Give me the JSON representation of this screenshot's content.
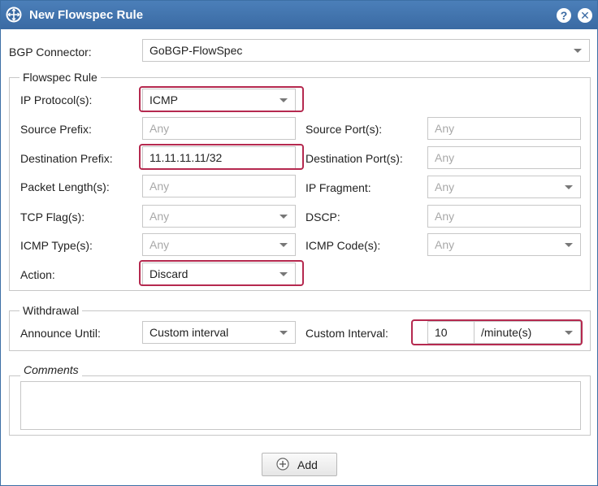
{
  "dialog": {
    "title": "New Flowspec Rule",
    "help_icon": "?",
    "close_icon": "✕"
  },
  "bgp_connector": {
    "label": "BGP Connector:",
    "value": "GoBGP-FlowSpec"
  },
  "flowspec_rule": {
    "legend": "Flowspec Rule",
    "ip_protocol": {
      "label": "IP Protocol(s):",
      "value": "ICMP"
    },
    "source_prefix": {
      "label": "Source Prefix:",
      "placeholder": "Any"
    },
    "source_port": {
      "label": "Source Port(s):",
      "placeholder": "Any"
    },
    "destination_prefix": {
      "label": "Destination Prefix:",
      "value": "11.11.11.11/32"
    },
    "destination_port": {
      "label": "Destination Port(s):",
      "placeholder": "Any"
    },
    "packet_length": {
      "label": "Packet Length(s):",
      "placeholder": "Any"
    },
    "ip_fragment": {
      "label": "IP Fragment:",
      "value": "Any"
    },
    "tcp_flags": {
      "label": "TCP Flag(s):",
      "value": "Any"
    },
    "dscp": {
      "label": "DSCP:",
      "placeholder": "Any"
    },
    "icmp_type": {
      "label": "ICMP Type(s):",
      "value": "Any"
    },
    "icmp_code": {
      "label": "ICMP Code(s):",
      "value": "Any"
    },
    "action": {
      "label": "Action:",
      "value": "Discard"
    }
  },
  "withdrawal": {
    "legend": "Withdrawal",
    "announce_until": {
      "label": "Announce Until:",
      "value": "Custom interval"
    },
    "custom_interval": {
      "label": "Custom Interval:",
      "value": "10",
      "unit": "/minute(s)"
    }
  },
  "comments": {
    "legend": "Comments",
    "value": ""
  },
  "add_button": {
    "label": "Add"
  },
  "colors": {
    "titlebar": "#3a6aa3",
    "highlight": "#b5294f",
    "border": "#c7c7c7"
  }
}
